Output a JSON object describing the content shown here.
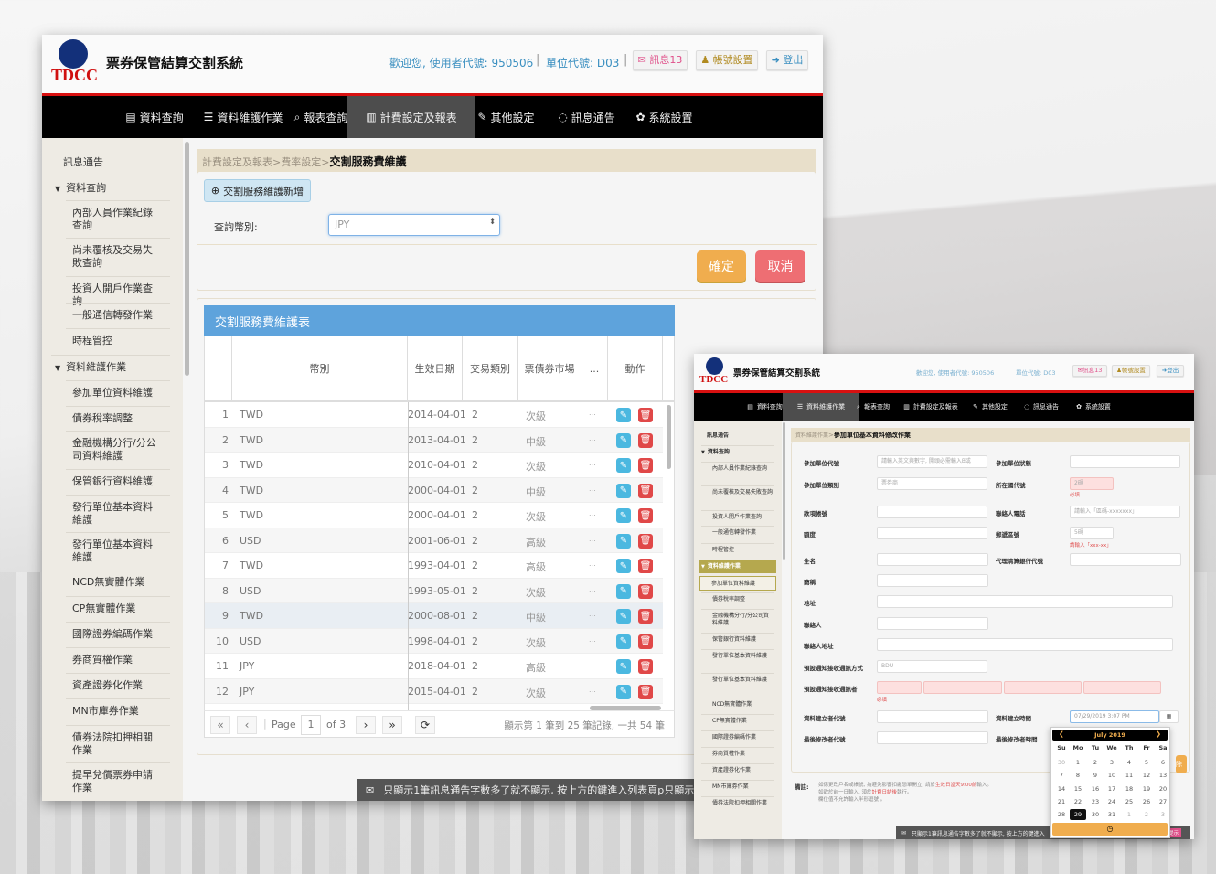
{
  "colors": {
    "nav_bg": "#000000",
    "nav_active": "#4d4d4d",
    "accent_red": "#d81010",
    "table_header": "#5ea3dc",
    "confirm": "#f0ad4e",
    "cancel": "#ee6e73",
    "edit": "#4bb8e0",
    "delete": "#e04848",
    "header_info": "#3a8fc0"
  },
  "header": {
    "logo_text": "TDCC",
    "title": "票券保管結算交割系統",
    "welcome": "歡迎您, 使用者代號: 950506",
    "unit": "單位代號: D03",
    "messages_label": "訊息13",
    "account_label": "帳號設置",
    "logout_label": "登出",
    "icons": [
      "envelope-icon",
      "user-icon",
      "sign-out-icon"
    ]
  },
  "nav": [
    {
      "label": "資料查詢",
      "icon": "search-doc-icon"
    },
    {
      "label": "資料維護作業",
      "icon": "list-icon"
    },
    {
      "label": "報表查詢",
      "icon": "zoom-icon"
    },
    {
      "label": "計費設定及報表",
      "icon": "bar-chart-icon"
    },
    {
      "label": "其他設定",
      "icon": "wrench-icon"
    },
    {
      "label": "訊息通告",
      "icon": "comment-icon"
    },
    {
      "label": "系統設置",
      "icon": "gear-icon"
    }
  ],
  "sidebar": {
    "items": [
      {
        "label": "訊息通告",
        "type": "top"
      },
      {
        "label": "資料查詢",
        "type": "group"
      },
      {
        "label": "內部人員作業紀錄查詢",
        "type": "sub"
      },
      {
        "label": "尚未覆核及交易失敗查詢",
        "type": "sub"
      },
      {
        "label": "投資人開戶作業查詢",
        "type": "sub"
      },
      {
        "label": "一般通信轉發作業",
        "type": "sub"
      },
      {
        "label": "時程管控",
        "type": "sub"
      },
      {
        "label": "資料維護作業",
        "type": "group"
      },
      {
        "label": "參加單位資料維護",
        "type": "sub"
      },
      {
        "label": "債券稅率調整",
        "type": "sub"
      },
      {
        "label": "金融機構分行/分公司資料維護",
        "type": "sub"
      },
      {
        "label": "保管銀行資料維護",
        "type": "sub"
      },
      {
        "label": "發行單位基本資料維護",
        "type": "sub"
      },
      {
        "label": "發行單位基本資料維護",
        "type": "sub"
      },
      {
        "label": "NCD無實體作業",
        "type": "sub"
      },
      {
        "label": "CP無實體作業",
        "type": "sub"
      },
      {
        "label": "國際證券編碼作業",
        "type": "sub"
      },
      {
        "label": "券商質權作業",
        "type": "sub"
      },
      {
        "label": "資產證券化作業",
        "type": "sub"
      },
      {
        "label": "MN市庫券作業",
        "type": "sub"
      },
      {
        "label": "債券法院扣押相關作業",
        "type": "sub"
      },
      {
        "label": "提早兌償票券申請作業",
        "type": "sub"
      }
    ]
  },
  "main": {
    "breadcrumb": [
      "計費設定及報表",
      "費率設定"
    ],
    "breadcrumb_sep": ">",
    "page_title": "交割服務費維護",
    "add_button": "交割服務維護新增",
    "query_label": "查詢幣別:",
    "query_value": "JPY",
    "confirm_label": "確定",
    "cancel_label": "取消",
    "table_title": "交割服務費維護表",
    "columns": [
      "",
      "幣別",
      "生效日期",
      "交易類別",
      "票債券市場",
      "...",
      "動作"
    ],
    "rows": [
      [
        "1",
        "TWD",
        "2014-04-01",
        "2",
        "次級",
        "..."
      ],
      [
        "2",
        "TWD",
        "2013-04-01",
        "2",
        "中級",
        "..."
      ],
      [
        "3",
        "TWD",
        "2010-04-01",
        "2",
        "次級",
        "..."
      ],
      [
        "4",
        "TWD",
        "2000-04-01",
        "2",
        "中級",
        "..."
      ],
      [
        "5",
        "TWD",
        "2000-04-01",
        "2",
        "次級",
        "..."
      ],
      [
        "6",
        "USD",
        "2001-06-01",
        "2",
        "高級",
        "..."
      ],
      [
        "7",
        "TWD",
        "1993-04-01",
        "2",
        "高級",
        "..."
      ],
      [
        "8",
        "USD",
        "1993-05-01",
        "2",
        "次級",
        "..."
      ],
      [
        "9",
        "TWD",
        "2000-08-01",
        "2",
        "中級",
        "..."
      ],
      [
        "10",
        "USD",
        "1998-04-01",
        "2",
        "次級",
        "..."
      ],
      [
        "11",
        "JPY",
        "2018-04-01",
        "2",
        "高級",
        "..."
      ],
      [
        "12",
        "JPY",
        "2015-04-01",
        "2",
        "次級",
        "..."
      ]
    ],
    "pager": {
      "page_label": "Page",
      "page": "1",
      "of_label": "of 3",
      "summary": "顯示第 1 筆到 25 筆記錄, 一共 54 筆"
    },
    "toast": "只顯示1筆訊息通告字數多了就不顯示, 按上方的鍵進入列表頁p只顯示1筆訊息通告"
  },
  "window2": {
    "nav_active": "資料維護作業",
    "sidebar_active_group": "資料維護作業",
    "sidebar_active_item": "參加單位資料維護",
    "breadcrumb": "資料維護作業",
    "page_title": "參加單位基本資料修改作業",
    "fields": {
      "unit_code": {
        "label": "參加單位代號",
        "placeholder": "請輸入英文與數字, 開頭必需輸入B或"
      },
      "unit_status": {
        "label": "參加單位狀態",
        "value": ""
      },
      "unit_type": {
        "label": "參加單位類別",
        "value": "票券商"
      },
      "country_code": {
        "label": "所在國代號",
        "placeholder": "2碼",
        "error": "必填"
      },
      "account_no": {
        "label": "款項帳號",
        "value": ""
      },
      "contact_phone": {
        "label": "聯絡人電話",
        "placeholder": "請輸入「區碼-xxxxxxx」"
      },
      "quota": {
        "label": "額度",
        "value": ""
      },
      "zip": {
        "label": "郵遞區號",
        "placeholder": "5碼",
        "error": "請輸入「xxx-xx」"
      },
      "full_name": {
        "label": "全名",
        "value": ""
      },
      "agent_bank": {
        "label": "代理清算銀行代號",
        "value": ""
      },
      "short_name": {
        "label": "簡稱",
        "value": ""
      },
      "address": {
        "label": "地址",
        "value": ""
      },
      "contact": {
        "label": "聯絡人",
        "value": ""
      },
      "contact_address": {
        "label": "聯絡人地址",
        "value": ""
      },
      "notify_method": {
        "label": "預設通知接收通訊方式",
        "value": "BDU"
      },
      "notify_receiver": {
        "label": "預設通知接收通訊者",
        "error": "必填"
      },
      "creator": {
        "label": "資料建立者代號",
        "value": ""
      },
      "created_time": {
        "label": "資料建立時間",
        "value": "07/29/2019 3:07 PM"
      },
      "modifier": {
        "label": "最後修改者代號",
        "value": ""
      },
      "modified_time": {
        "label": "最後修改者時間",
        "value": ""
      }
    },
    "notes_label": "備註:",
    "notes": [
      {
        "pre": "如係更改戶名或帳號, 為避免影響扣繳憑單開立, 請於",
        "hl": "生效日當天9:00前",
        "post": "輸入。"
      },
      {
        "pre": "如欲於前一日輸入, 須於",
        "hl": "計費日結後",
        "post": "執行。"
      },
      {
        "pre": "欄位值不允許輸入半形逗號 。",
        "hl": "",
        "post": ""
      }
    ],
    "button_partial": "除",
    "toast": "只顯示1筆訊息通告字數多了就不顯示, 按上方的鍵進入",
    "toast_button": "提示",
    "calendar": {
      "month": "July 2019",
      "weekdays": [
        "Su",
        "Mo",
        "Tu",
        "We",
        "Th",
        "Fr",
        "Sa"
      ],
      "days": [
        [
          "30",
          "1",
          "2",
          "3",
          "4",
          "5",
          "6"
        ],
        [
          "7",
          "8",
          "9",
          "10",
          "11",
          "12",
          "13"
        ],
        [
          "14",
          "15",
          "16",
          "17",
          "18",
          "19",
          "20"
        ],
        [
          "21",
          "22",
          "23",
          "24",
          "25",
          "26",
          "27"
        ],
        [
          "28",
          "29",
          "30",
          "31",
          "1",
          "2",
          "3"
        ]
      ],
      "selected": "29"
    }
  }
}
